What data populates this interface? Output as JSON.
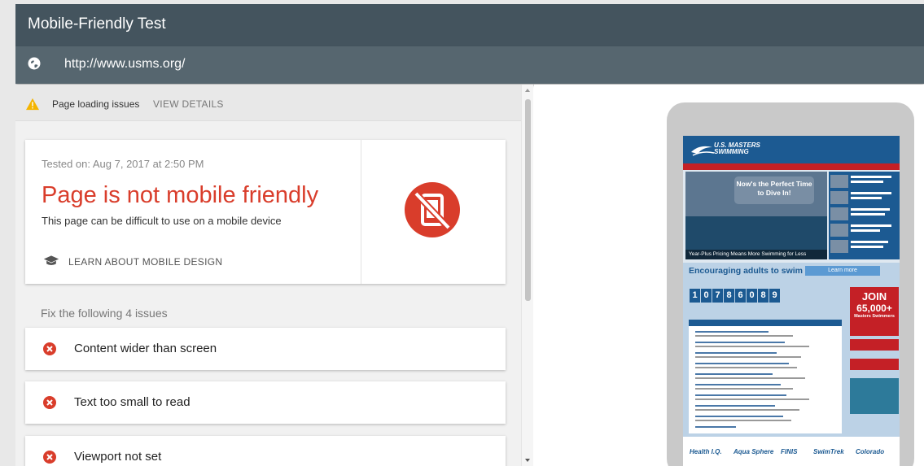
{
  "header": {
    "title": "Mobile-Friendly Test"
  },
  "urlbar": {
    "url": "http://www.usms.org/",
    "icon": "globe-icon"
  },
  "warning": {
    "text": "Page loading issues",
    "link": "VIEW DETAILS",
    "icon": "warning-icon"
  },
  "result": {
    "tested_on": "Tested on: Aug 7, 2017 at 2:50 PM",
    "verdict": "Page is not mobile friendly",
    "description": "This page can be difficult to use on a mobile device",
    "learn_link": "LEARN ABOUT MOBILE DESIGN",
    "verdict_color": "#d93d2b",
    "status_icon": "not-mobile-friendly-icon"
  },
  "issues": {
    "heading": "Fix the following 4 issues",
    "items": [
      {
        "label": "Content wider than screen"
      },
      {
        "label": "Text too small to read"
      },
      {
        "label": "Viewport not set"
      }
    ]
  },
  "preview": {
    "logo_text": "U.S. MASTERS SWIMMING",
    "hero_text": "Now's the Perfect Time to Dive In!",
    "hero_banner": "Year-Plus Pricing Means More Swimming for Less",
    "encourage": "Encouraging adults to swim",
    "learn_more": "Learn more",
    "counter_digits": [
      "1",
      "0",
      "7",
      "8",
      "6",
      "0",
      "8",
      "9"
    ],
    "join": {
      "line1": "JOIN",
      "line2": "65,000+",
      "line3": "Masters Swimmers"
    },
    "sponsors": [
      "Health I.Q.",
      "Aqua Sphere",
      "FINIS",
      "SwimTrek",
      "Colorado"
    ]
  }
}
